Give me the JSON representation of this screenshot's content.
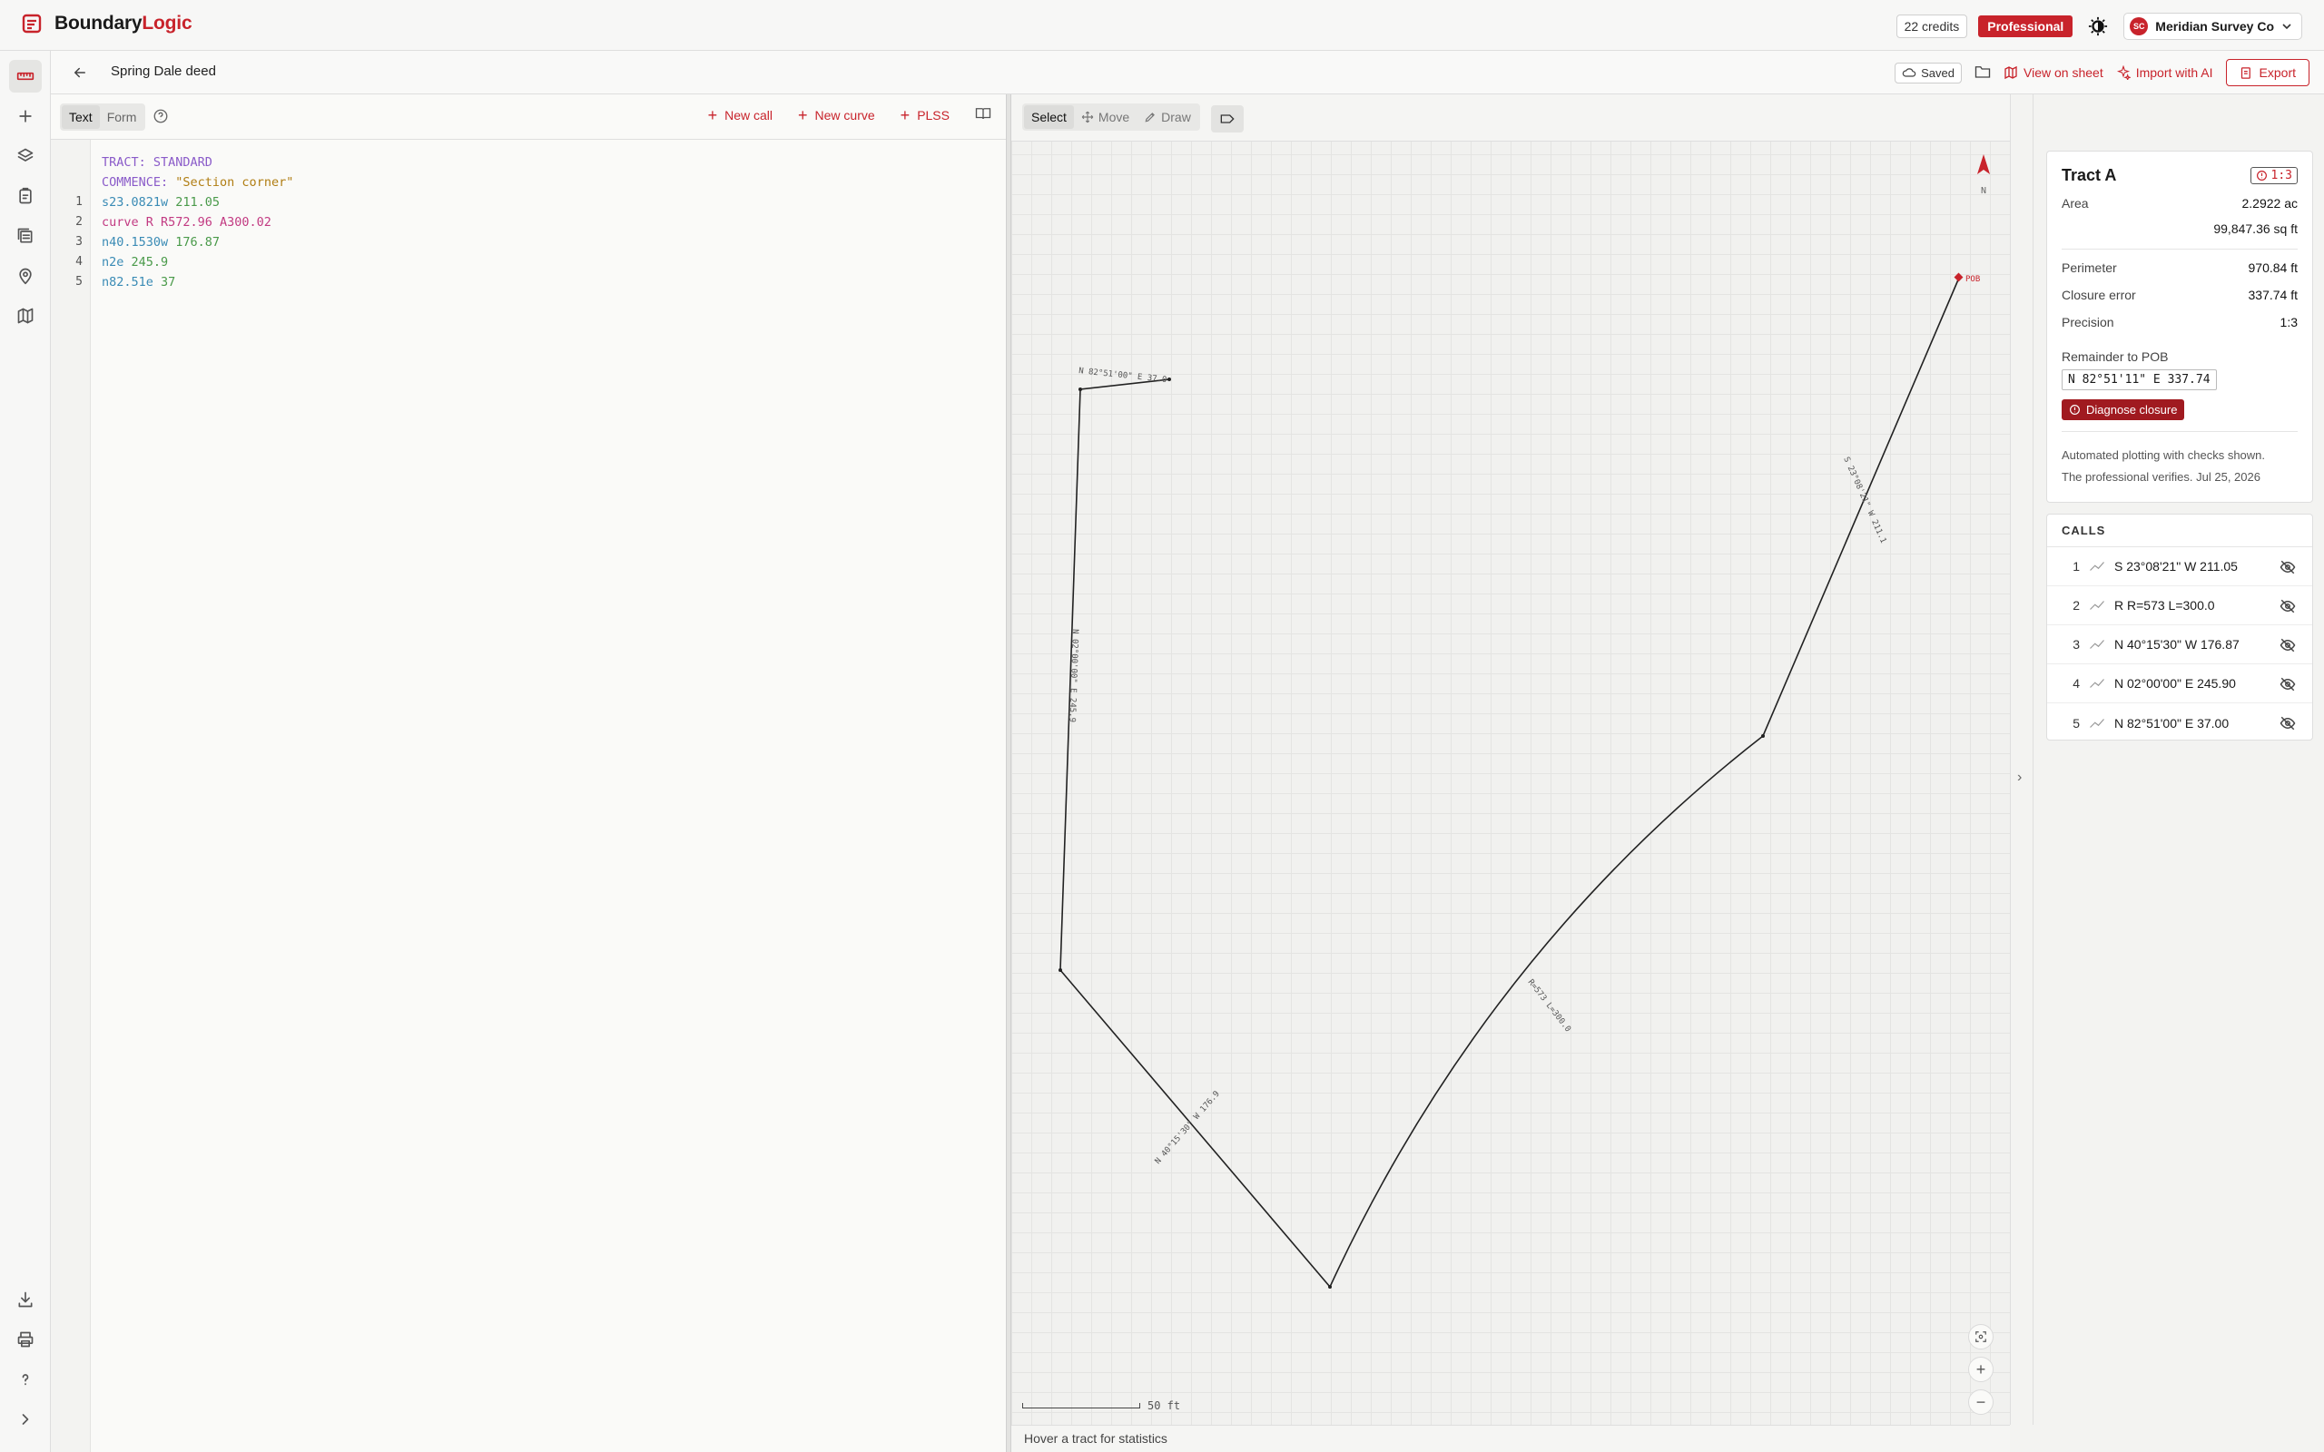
{
  "app": {
    "brand_part1": "Boundary",
    "brand_part2": "Logic",
    "credits": "22 credits",
    "plan": "Professional",
    "account_initials": "SC",
    "account_name": "Meridian Survey Co"
  },
  "document": {
    "title": "Spring Dale deed",
    "saved": "Saved",
    "view_on_sheet": "View on sheet",
    "import_ai": "Import with AI",
    "export": "Export"
  },
  "editor": {
    "tab_text": "Text",
    "tab_form": "Form",
    "new_call": "New call",
    "new_curve": "New curve",
    "plss": "PLSS",
    "header_lines": [
      {
        "kw": "TRACT:",
        "val": " STANDARD"
      },
      {
        "kw": "COMMENCE:",
        "val": " \"Section corner\""
      }
    ],
    "lines": [
      {
        "n": "1",
        "cmd": "s23.0821w",
        "arg": " 211.05"
      },
      {
        "n": "2",
        "cmd": "curve R R572.96 A300.02",
        "arg": ""
      },
      {
        "n": "3",
        "cmd": "n40.1530w",
        "arg": " 176.87"
      },
      {
        "n": "4",
        "cmd": "n2e",
        "arg": " 245.9"
      },
      {
        "n": "5",
        "cmd": "n82.51e",
        "arg": " 37"
      }
    ]
  },
  "map": {
    "tool_select": "Select",
    "tool_move": "Move",
    "tool_draw": "Draw",
    "north": "N",
    "pob": "POB",
    "scale": "50 ft",
    "status": "Hover a tract for statistics",
    "labels": {
      "l1": "S 23°08'21\" W 211.1",
      "l2": "R=573 L=300.0",
      "l3": "N 40°15'30\" W 176.9",
      "l4": "N 02°00'00\" E 245.9",
      "l5": "N 82°51'00\" E 37.0"
    }
  },
  "panel": {
    "tract_name": "Tract A",
    "precision_badge": "1:3",
    "area_label": "Area",
    "area_ac": "2.2922 ac",
    "area_sqft": "99,847.36 sq ft",
    "perimeter_label": "Perimeter",
    "perimeter": "970.84 ft",
    "closure_label": "Closure error",
    "closure": "337.74 ft",
    "precision_label": "Precision",
    "precision": "1:3",
    "remainder_label": "Remainder to POB",
    "remainder": "N 82°51'11\" E 337.74",
    "diagnose": "Diagnose closure",
    "note1": "Automated plotting with checks shown.",
    "note2": "The professional verifies. Jul 25, 2026",
    "calls_title": "CALLS",
    "calls": [
      {
        "n": "1",
        "text": "S 23°08'21\" W 211.05"
      },
      {
        "n": "2",
        "text": "R R=573 L=300.0"
      },
      {
        "n": "3",
        "text": "N 40°15'30\" W 176.87"
      },
      {
        "n": "4",
        "text": "N 02°00'00\" E 245.90"
      },
      {
        "n": "5",
        "text": "N 82°51'00\" E 37.00"
      }
    ]
  },
  "colors": {
    "accent": "#c8232b",
    "accent_dark": "#a01a20"
  }
}
